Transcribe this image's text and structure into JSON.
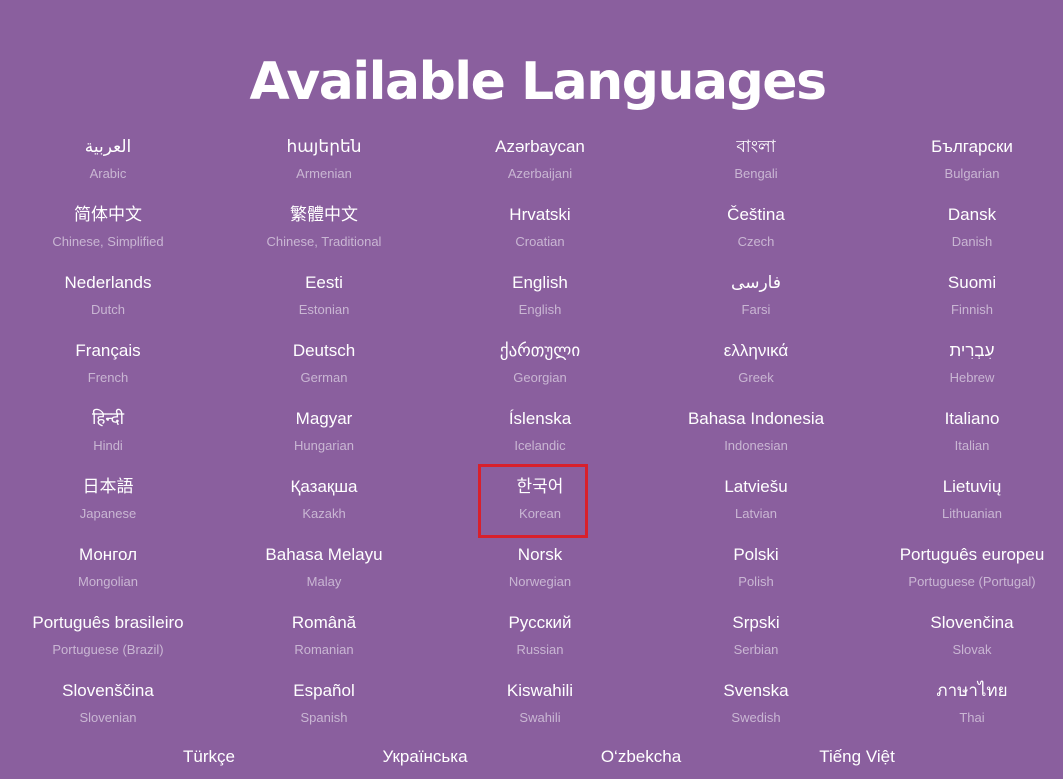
{
  "page": {
    "title": "Available Languages"
  },
  "languages": [
    {
      "native": "العربية",
      "english": "Arabic"
    },
    {
      "native": "հայերեն",
      "english": "Armenian"
    },
    {
      "native": "Azərbaycan",
      "english": "Azerbaijani"
    },
    {
      "native": "বাংলা",
      "english": "Bengali"
    },
    {
      "native": "Български",
      "english": "Bulgarian"
    },
    {
      "native": "简体中文",
      "english": "Chinese, Simplified"
    },
    {
      "native": "繁體中文",
      "english": "Chinese, Traditional"
    },
    {
      "native": "Hrvatski",
      "english": "Croatian"
    },
    {
      "native": "Čeština",
      "english": "Czech"
    },
    {
      "native": "Dansk",
      "english": "Danish"
    },
    {
      "native": "Nederlands",
      "english": "Dutch"
    },
    {
      "native": "Eesti",
      "english": "Estonian"
    },
    {
      "native": "English",
      "english": "English"
    },
    {
      "native": "فارسی",
      "english": "Farsi"
    },
    {
      "native": "Suomi",
      "english": "Finnish"
    },
    {
      "native": "Français",
      "english": "French"
    },
    {
      "native": "Deutsch",
      "english": "German"
    },
    {
      "native": "ქართული",
      "english": "Georgian"
    },
    {
      "native": "ελληνικά",
      "english": "Greek"
    },
    {
      "native": "עִבְרִית",
      "english": "Hebrew"
    },
    {
      "native": "हिन्दी",
      "english": "Hindi"
    },
    {
      "native": "Magyar",
      "english": "Hungarian"
    },
    {
      "native": "Íslenska",
      "english": "Icelandic"
    },
    {
      "native": "Bahasa Indonesia",
      "english": "Indonesian"
    },
    {
      "native": "Italiano",
      "english": "Italian"
    },
    {
      "native": "日本語",
      "english": "Japanese"
    },
    {
      "native": "Қазақша",
      "english": "Kazakh"
    },
    {
      "native": "한국어",
      "english": "Korean"
    },
    {
      "native": "Latviešu",
      "english": "Latvian"
    },
    {
      "native": "Lietuvių",
      "english": "Lithuanian"
    },
    {
      "native": "Монгол",
      "english": "Mongolian"
    },
    {
      "native": "Bahasa Melayu",
      "english": "Malay"
    },
    {
      "native": "Norsk",
      "english": "Norwegian"
    },
    {
      "native": "Polski",
      "english": "Polish"
    },
    {
      "native": "Português europeu",
      "english": "Portuguese (Portugal)"
    },
    {
      "native": "Português brasileiro",
      "english": "Portuguese (Brazil)"
    },
    {
      "native": "Română",
      "english": "Romanian"
    },
    {
      "native": "Русский",
      "english": "Russian"
    },
    {
      "native": "Srpski",
      "english": "Serbian"
    },
    {
      "native": "Slovenčina",
      "english": "Slovak"
    },
    {
      "native": "Slovenščina",
      "english": "Slovenian"
    },
    {
      "native": "Español",
      "english": "Spanish"
    },
    {
      "native": "Kiswahili",
      "english": "Swahili"
    },
    {
      "native": "Svenska",
      "english": "Swedish"
    },
    {
      "native": "ภาษาไทย",
      "english": "Thai"
    }
  ],
  "last_row": [
    {
      "native": "Türkçe"
    },
    {
      "native": "Українська"
    },
    {
      "native": "O‘zbekcha"
    },
    {
      "native": "Tiếng Việt"
    }
  ],
  "highlight": {
    "language": "Korean",
    "color": "#d8202c"
  },
  "colors": {
    "background": "#8a5f9e",
    "native_text": "#ffffff",
    "english_text": "#c9b6d3"
  }
}
